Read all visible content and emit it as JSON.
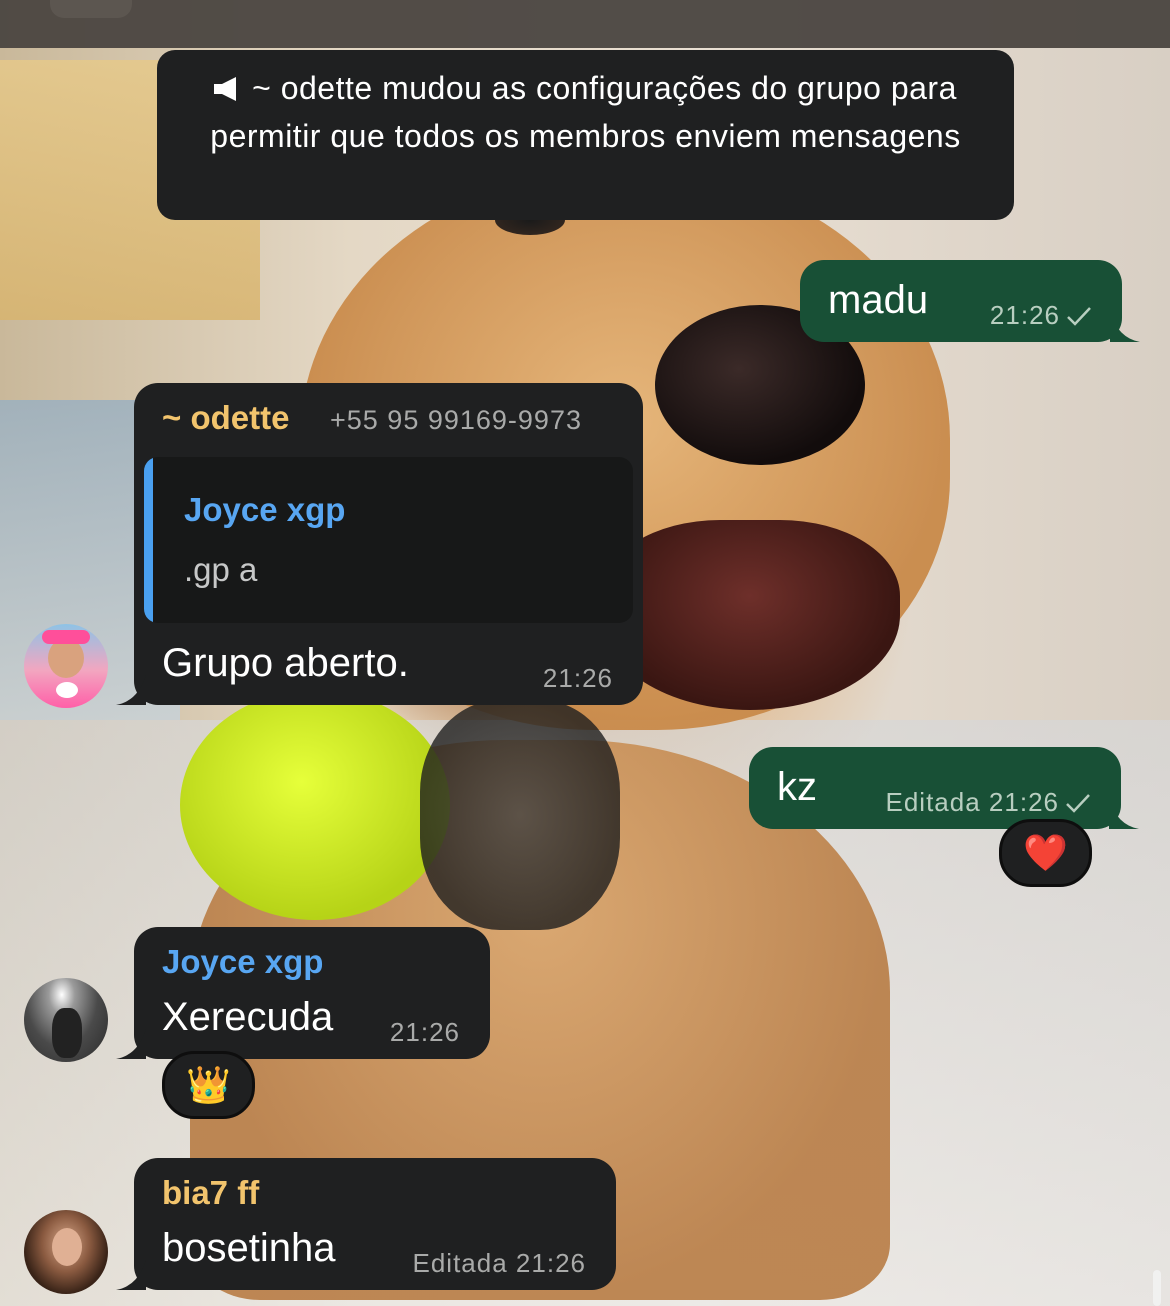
{
  "system_message": {
    "text": "~ odette mudou as configurações do grupo para permitir que todos os membros enviem mensagens",
    "icon": "megaphone-muted-icon"
  },
  "messages": [
    {
      "direction": "out",
      "text": "madu",
      "time": "21:26",
      "status": "sent"
    },
    {
      "direction": "in",
      "sender": "~ odette",
      "sender_color": "#f2c46d",
      "phone": "+55 95 99169-9973",
      "reply": {
        "sender": "Joyce xgp",
        "text": ".gp a"
      },
      "text": "Grupo aberto.",
      "time": "21:26"
    },
    {
      "direction": "out",
      "text": "kz",
      "edited_label": "Editada",
      "time": "21:26",
      "status": "sent",
      "reaction": "❤️"
    },
    {
      "direction": "in",
      "sender": "Joyce xgp",
      "sender_color": "#58a6f2",
      "text": "Xerecuda",
      "time": "21:26",
      "reaction": "👑"
    },
    {
      "direction": "in",
      "sender": "bia7 ff",
      "sender_color": "#f2c46d",
      "text": "bosetinha",
      "edited_label": "Editada",
      "time": "21:26"
    }
  ],
  "colors": {
    "incoming": "#1f2021",
    "outgoing": "#185036",
    "quote_bar": "#4aa0f0"
  }
}
